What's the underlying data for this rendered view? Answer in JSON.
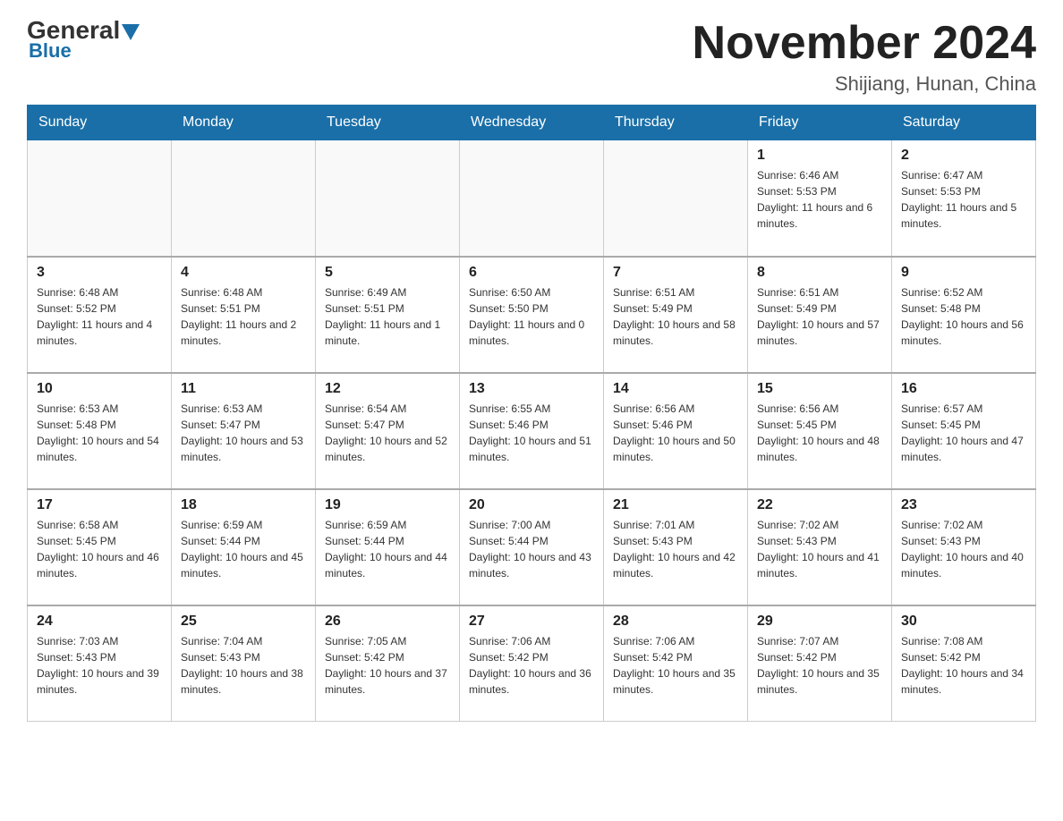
{
  "header": {
    "logo_general": "General",
    "logo_blue": "Blue",
    "title": "November 2024",
    "subtitle": "Shijiang, Hunan, China"
  },
  "weekdays": [
    "Sunday",
    "Monday",
    "Tuesday",
    "Wednesday",
    "Thursday",
    "Friday",
    "Saturday"
  ],
  "weeks": [
    [
      {
        "day": "",
        "info": ""
      },
      {
        "day": "",
        "info": ""
      },
      {
        "day": "",
        "info": ""
      },
      {
        "day": "",
        "info": ""
      },
      {
        "day": "",
        "info": ""
      },
      {
        "day": "1",
        "info": "Sunrise: 6:46 AM\nSunset: 5:53 PM\nDaylight: 11 hours and 6 minutes."
      },
      {
        "day": "2",
        "info": "Sunrise: 6:47 AM\nSunset: 5:53 PM\nDaylight: 11 hours and 5 minutes."
      }
    ],
    [
      {
        "day": "3",
        "info": "Sunrise: 6:48 AM\nSunset: 5:52 PM\nDaylight: 11 hours and 4 minutes."
      },
      {
        "day": "4",
        "info": "Sunrise: 6:48 AM\nSunset: 5:51 PM\nDaylight: 11 hours and 2 minutes."
      },
      {
        "day": "5",
        "info": "Sunrise: 6:49 AM\nSunset: 5:51 PM\nDaylight: 11 hours and 1 minute."
      },
      {
        "day": "6",
        "info": "Sunrise: 6:50 AM\nSunset: 5:50 PM\nDaylight: 11 hours and 0 minutes."
      },
      {
        "day": "7",
        "info": "Sunrise: 6:51 AM\nSunset: 5:49 PM\nDaylight: 10 hours and 58 minutes."
      },
      {
        "day": "8",
        "info": "Sunrise: 6:51 AM\nSunset: 5:49 PM\nDaylight: 10 hours and 57 minutes."
      },
      {
        "day": "9",
        "info": "Sunrise: 6:52 AM\nSunset: 5:48 PM\nDaylight: 10 hours and 56 minutes."
      }
    ],
    [
      {
        "day": "10",
        "info": "Sunrise: 6:53 AM\nSunset: 5:48 PM\nDaylight: 10 hours and 54 minutes."
      },
      {
        "day": "11",
        "info": "Sunrise: 6:53 AM\nSunset: 5:47 PM\nDaylight: 10 hours and 53 minutes."
      },
      {
        "day": "12",
        "info": "Sunrise: 6:54 AM\nSunset: 5:47 PM\nDaylight: 10 hours and 52 minutes."
      },
      {
        "day": "13",
        "info": "Sunrise: 6:55 AM\nSunset: 5:46 PM\nDaylight: 10 hours and 51 minutes."
      },
      {
        "day": "14",
        "info": "Sunrise: 6:56 AM\nSunset: 5:46 PM\nDaylight: 10 hours and 50 minutes."
      },
      {
        "day": "15",
        "info": "Sunrise: 6:56 AM\nSunset: 5:45 PM\nDaylight: 10 hours and 48 minutes."
      },
      {
        "day": "16",
        "info": "Sunrise: 6:57 AM\nSunset: 5:45 PM\nDaylight: 10 hours and 47 minutes."
      }
    ],
    [
      {
        "day": "17",
        "info": "Sunrise: 6:58 AM\nSunset: 5:45 PM\nDaylight: 10 hours and 46 minutes."
      },
      {
        "day": "18",
        "info": "Sunrise: 6:59 AM\nSunset: 5:44 PM\nDaylight: 10 hours and 45 minutes."
      },
      {
        "day": "19",
        "info": "Sunrise: 6:59 AM\nSunset: 5:44 PM\nDaylight: 10 hours and 44 minutes."
      },
      {
        "day": "20",
        "info": "Sunrise: 7:00 AM\nSunset: 5:44 PM\nDaylight: 10 hours and 43 minutes."
      },
      {
        "day": "21",
        "info": "Sunrise: 7:01 AM\nSunset: 5:43 PM\nDaylight: 10 hours and 42 minutes."
      },
      {
        "day": "22",
        "info": "Sunrise: 7:02 AM\nSunset: 5:43 PM\nDaylight: 10 hours and 41 minutes."
      },
      {
        "day": "23",
        "info": "Sunrise: 7:02 AM\nSunset: 5:43 PM\nDaylight: 10 hours and 40 minutes."
      }
    ],
    [
      {
        "day": "24",
        "info": "Sunrise: 7:03 AM\nSunset: 5:43 PM\nDaylight: 10 hours and 39 minutes."
      },
      {
        "day": "25",
        "info": "Sunrise: 7:04 AM\nSunset: 5:43 PM\nDaylight: 10 hours and 38 minutes."
      },
      {
        "day": "26",
        "info": "Sunrise: 7:05 AM\nSunset: 5:42 PM\nDaylight: 10 hours and 37 minutes."
      },
      {
        "day": "27",
        "info": "Sunrise: 7:06 AM\nSunset: 5:42 PM\nDaylight: 10 hours and 36 minutes."
      },
      {
        "day": "28",
        "info": "Sunrise: 7:06 AM\nSunset: 5:42 PM\nDaylight: 10 hours and 35 minutes."
      },
      {
        "day": "29",
        "info": "Sunrise: 7:07 AM\nSunset: 5:42 PM\nDaylight: 10 hours and 35 minutes."
      },
      {
        "day": "30",
        "info": "Sunrise: 7:08 AM\nSunset: 5:42 PM\nDaylight: 10 hours and 34 minutes."
      }
    ]
  ]
}
